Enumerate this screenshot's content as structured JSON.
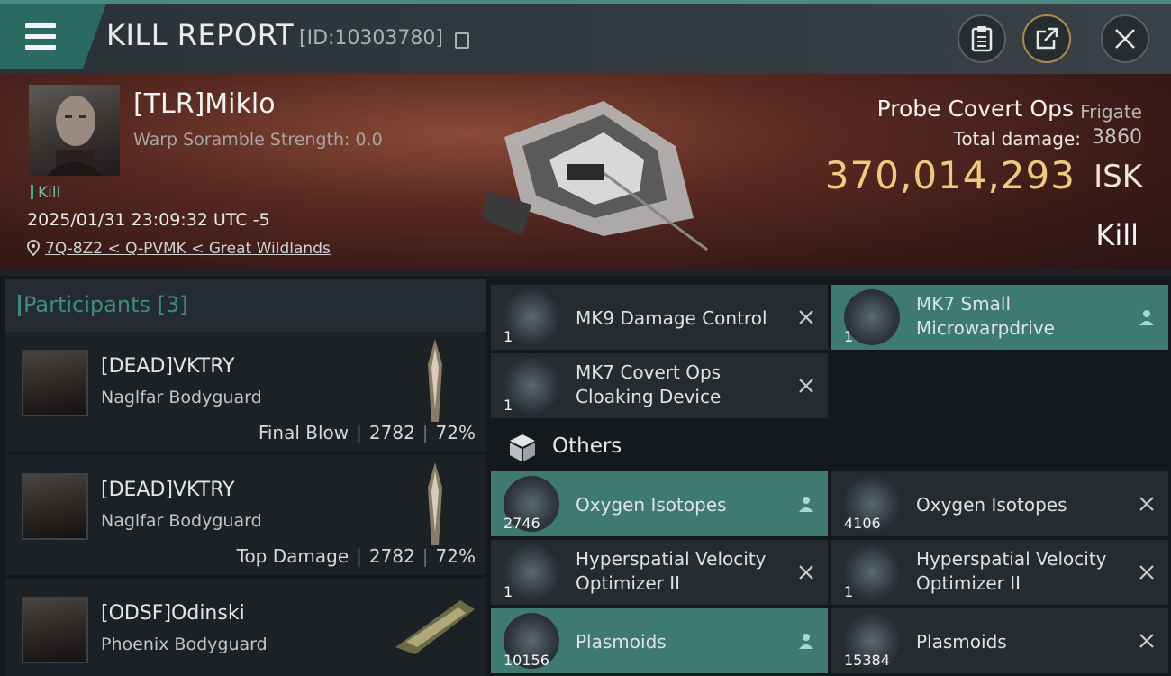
{
  "header": {
    "title": "KILL REPORT",
    "report_id": "[ID:10303780]"
  },
  "victim": {
    "name": "[TLR]Miklo",
    "warp_scramble": "Warp Soramble Strength: 0.0",
    "tag": "Kill",
    "datetime": "2025/01/31 23:09:32 UTC -5",
    "location": "7Q-8Z2 < Q-PVMK < Great Wildlands",
    "ship_name": "Probe Covert Ops",
    "ship_class": "Frigate",
    "total_damage_label": "Total damage:",
    "total_damage": "3860",
    "isk_value": "370,014,293",
    "isk_unit": "ISK",
    "result": "Kill"
  },
  "participants": {
    "header": "Participants [3]",
    "rows": [
      {
        "name": "[DEAD]VKTRY",
        "ship": "Naglfar Bodyguard",
        "role": "Final Blow",
        "damage": "2782",
        "percent": "72%"
      },
      {
        "name": "[DEAD]VKTRY",
        "ship": "Naglfar Bodyguard",
        "role": "Top Damage",
        "damage": "2782",
        "percent": "72%"
      },
      {
        "name": "[ODSF]Odinski",
        "ship": "Phoenix Bodyguard",
        "role": "",
        "damage": "",
        "percent": ""
      }
    ]
  },
  "items": {
    "fitted": [
      {
        "name": "MK9 Damage Control",
        "qty": "1",
        "status": "destroyed"
      },
      {
        "name_line1": "MK7 Small",
        "name_line2": "Microwarpdrive",
        "qty": "1",
        "status": "dropped"
      },
      {
        "name_line1": "MK7 Covert Ops",
        "name_line2": "Cloaking Device",
        "qty": "1",
        "status": "destroyed"
      }
    ],
    "others_header": "Others",
    "others": [
      {
        "name": "Oxygen Isotopes",
        "qty": "2746",
        "status": "dropped"
      },
      {
        "name": "Oxygen Isotopes",
        "qty": "4106",
        "status": "destroyed"
      },
      {
        "name_line1": "Hyperspatial Velocity",
        "name_line2": "Optimizer II",
        "qty": "1",
        "status": "destroyed"
      },
      {
        "name_line1": "Hyperspatial Velocity",
        "name_line2": "Optimizer II",
        "qty": "1",
        "status": "destroyed"
      },
      {
        "name": "Plasmoids",
        "qty": "10156",
        "status": "dropped"
      },
      {
        "name": "Plasmoids",
        "qty": "15384",
        "status": "destroyed"
      }
    ]
  },
  "colors": {
    "accent_teal": "#3f7a70",
    "isk_gold": "#f0c880",
    "header_bar": "#2a6a62"
  }
}
